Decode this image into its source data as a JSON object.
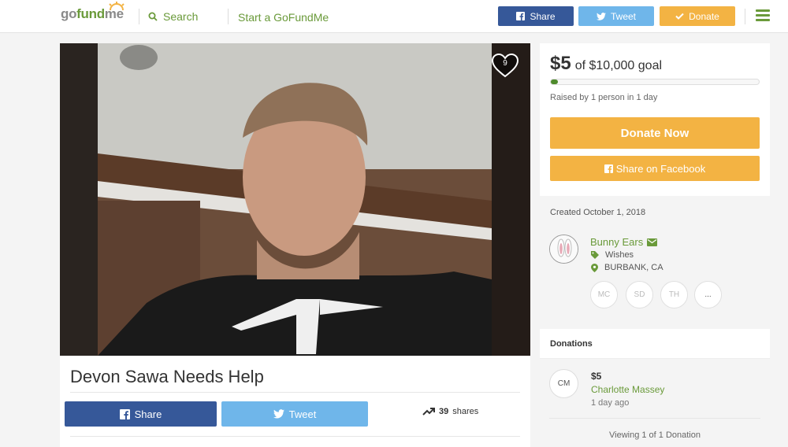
{
  "header": {
    "logo_part1": "go",
    "logo_part2": "fund",
    "logo_part3": "me",
    "search_label": "Search",
    "start_label": "Start a GoFundMe",
    "share_label": "Share",
    "tweet_label": "Tweet",
    "donate_label": "Donate"
  },
  "colors": {
    "brand_green": "#6a9a3a",
    "facebook_blue": "#365899",
    "twitter_blue": "#6fb6ea",
    "donate_orange": "#f3b343"
  },
  "campaign": {
    "heart_count": "9",
    "title": "Devon Sawa Needs Help",
    "share_label": "Share",
    "tweet_label": "Tweet",
    "shares_count": "39",
    "shares_label": "shares"
  },
  "goal": {
    "raised": "$5",
    "goal_text": "of $10,000 goal",
    "progress_fraction": 0.0005,
    "raised_by": "Raised by 1 person in 1 day",
    "donate_now_label": "Donate Now",
    "share_facebook_label": "Share on Facebook"
  },
  "organizer": {
    "created": "Created October 1, 2018",
    "name": "Bunny Ears",
    "category": "Wishes",
    "location": "BURBANK, CA",
    "supporter_initials": [
      "MC",
      "SD",
      "TH"
    ],
    "more_label": "..."
  },
  "donations": {
    "header": "Donations",
    "items": [
      {
        "initials": "CM",
        "amount": "$5",
        "name": "Charlotte Massey",
        "time": "1 day ago"
      }
    ],
    "viewing": "Viewing 1 of 1 Donation"
  },
  "icons": [
    "search-icon",
    "facebook-icon",
    "twitter-icon",
    "check-icon",
    "hamburger-icon",
    "heart-icon",
    "trending-icon",
    "envelope-icon",
    "tag-icon",
    "map-pin-icon"
  ]
}
